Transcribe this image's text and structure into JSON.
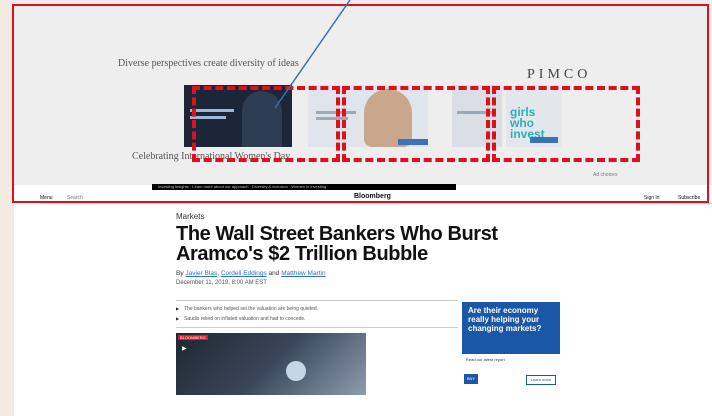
{
  "ad": {
    "tagline": "Diverse perspectives create diversity of ideas",
    "brand": "PIMCO",
    "caption": "Celebrating International Women's Day",
    "small_link": "Ad choices",
    "strip_text": "Investing insights · Learn more about our approach · Diversity & inclusion · Women in investing",
    "card4_text": "girls who invest"
  },
  "nav": {
    "menu_label": "Menu",
    "search_label": "Search",
    "logo": "Bloomberg",
    "signin_label": "Sign In",
    "subscribe_label": "Subscribe"
  },
  "article": {
    "section": "Markets",
    "headline": "The Wall Street Bankers Who Burst Aramco's $2 Trillion Bubble",
    "byline_prefix": "By",
    "authors": [
      "Javier Blas",
      "Cordell Eddings",
      "Matthew Martin"
    ],
    "date": "December 11, 2019, 8:00 AM EST",
    "bullets": [
      "The bankers who helped set the valuation are being quieted.",
      "Saudis relied on inflated valuation and had to concede."
    ],
    "photo_badge": "BLOOMBERG",
    "play_icon": "play-icon"
  },
  "side_ad": {
    "headline": "Are their economy really helping your changing markets?",
    "sub": "Read our latest report",
    "logo": "BNY",
    "button": "Learn more"
  },
  "annotation": {
    "color": "#e0101a",
    "arrow_color": "#3a6fb0"
  }
}
